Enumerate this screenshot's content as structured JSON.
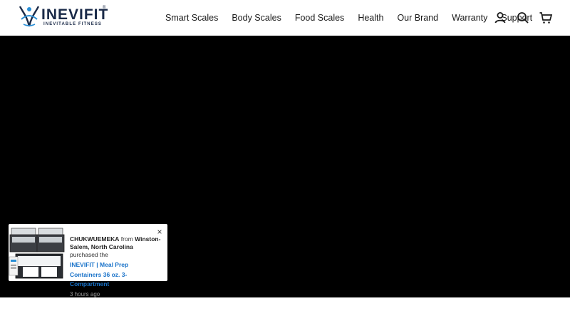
{
  "brand": {
    "name": "INEVIFIT",
    "registered_mark": "®",
    "tagline": "INEVITABLE FITNESS",
    "colors": {
      "navy": "#1a2a48",
      "accent_blue": "#2a8fd6"
    }
  },
  "nav": {
    "items": [
      {
        "label": "Smart Scales"
      },
      {
        "label": "Body Scales"
      },
      {
        "label": "Food Scales"
      },
      {
        "label": "Health"
      },
      {
        "label": "Our Brand"
      },
      {
        "label": "Warranty"
      },
      {
        "label": "Support"
      }
    ],
    "icons": [
      "user-icon",
      "search-icon",
      "cart-icon"
    ]
  },
  "hero": {
    "background": "#000000"
  },
  "purchase_toast": {
    "buyer": "CHUKWUEMEKA",
    "from_word": "from",
    "location": "Winston-Salem, North Carolina",
    "action": "purchased the",
    "product": "INEVIFIT | Meal Prep Containers 36 oz. 3-Compartment",
    "time_ago": "3 hours ago",
    "close_glyph": "×",
    "image_icon": "meal-prep-containers-image"
  }
}
